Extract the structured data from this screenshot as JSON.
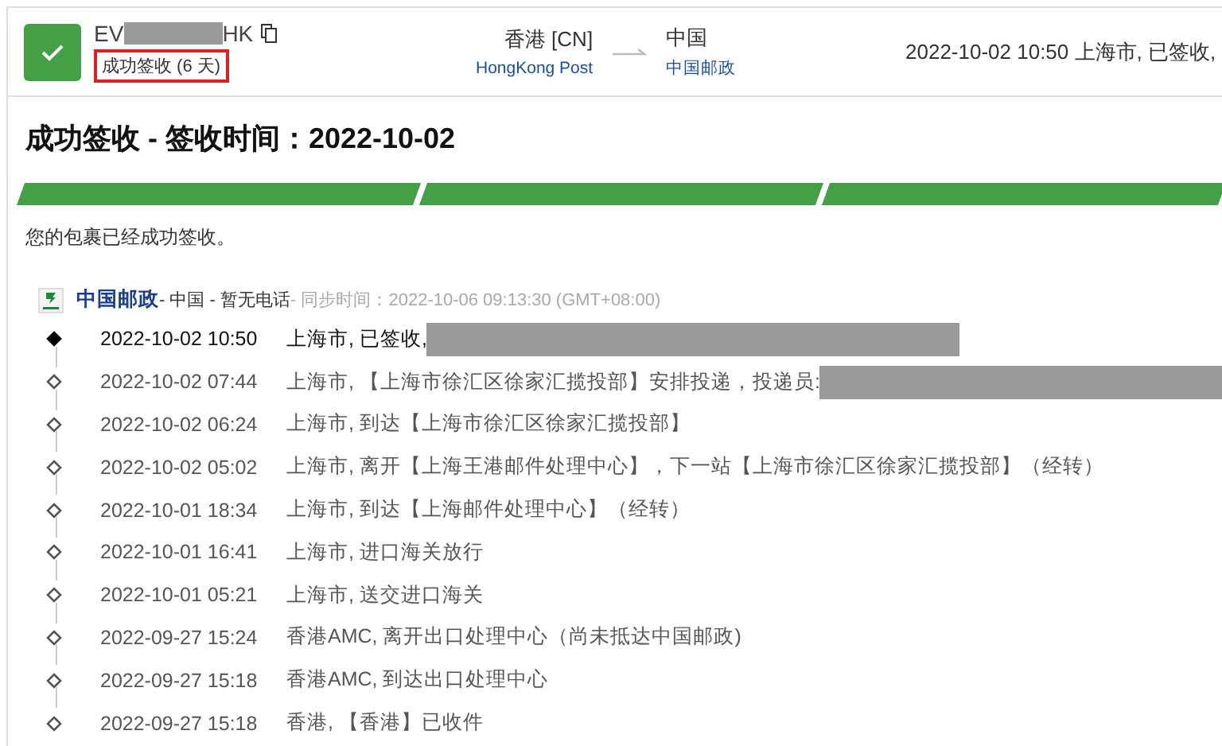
{
  "header": {
    "tracking_prefix": "EV",
    "tracking_suffix": "HK",
    "status_badge": "成功签收 (6 天)",
    "origin": {
      "country": "香港 [CN]",
      "carrier": "HongKong Post"
    },
    "destination": {
      "country": "中国",
      "carrier": "中国邮政"
    },
    "latest_event": "2022-10-02 10:50  上海市, 已签收,"
  },
  "title": "成功签收 - 签收时间：2022-10-02",
  "progress_segments": [
    {
      "done": true
    },
    {
      "done": true
    },
    {
      "done": true
    }
  ],
  "status_text": "您的包裹已经成功签收。",
  "carrier_row": {
    "name": "中国邮政",
    "details": " - 中国 - 暂无电话",
    "sync": " - 同步时间：2022-10-06 09:13:30 (GMT+08:00)"
  },
  "events": [
    {
      "time": "2022-10-02 10:50",
      "text": "上海市, 已签收,",
      "current": true,
      "redacted": true
    },
    {
      "time": "2022-10-02 07:44",
      "text": "上海市, 【上海市徐汇区徐家汇揽投部】安排投递，投递员:",
      "current": false,
      "redacted": true
    },
    {
      "time": "2022-10-02 06:24",
      "text": "上海市, 到达【上海市徐汇区徐家汇揽投部】",
      "current": false,
      "redacted": false
    },
    {
      "time": "2022-10-02 05:02",
      "text": "上海市, 离开【上海王港邮件处理中心】，下一站【上海市徐汇区徐家汇揽投部】（经转）",
      "current": false,
      "redacted": false
    },
    {
      "time": "2022-10-01 18:34",
      "text": "上海市, 到达【上海邮件处理中心】（经转）",
      "current": false,
      "redacted": false
    },
    {
      "time": "2022-10-01 16:41",
      "text": "上海市, 进口海关放行",
      "current": false,
      "redacted": false
    },
    {
      "time": "2022-10-01 05:21",
      "text": "上海市, 送交进口海关",
      "current": false,
      "redacted": false
    },
    {
      "time": "2022-09-27 15:24",
      "text": "香港AMC, 离开出口处理中心（尚未抵达中国邮政)",
      "current": false,
      "redacted": false
    },
    {
      "time": "2022-09-27 15:18",
      "text": "香港AMC, 到达出口处理中心",
      "current": false,
      "redacted": false
    },
    {
      "time": "2022-09-27 15:18",
      "text": "香港, 【香港】已收件",
      "current": false,
      "redacted": false
    }
  ]
}
